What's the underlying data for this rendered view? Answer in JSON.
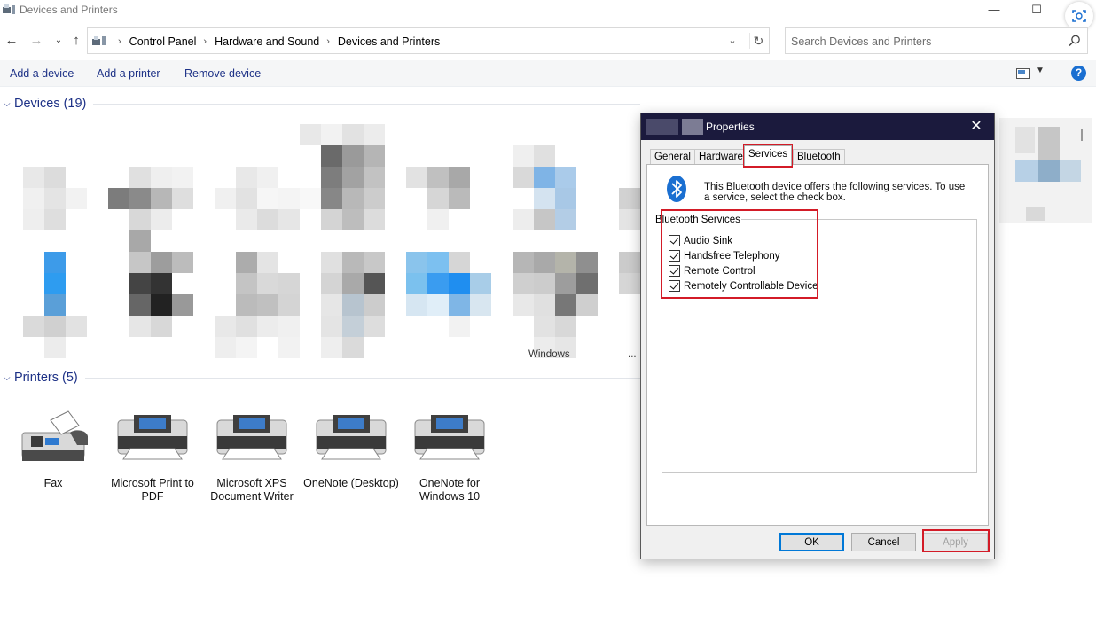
{
  "window": {
    "title": "Devices and Printers",
    "minimize_glyph": "—",
    "maximize_glyph": "☐",
    "close_glyph": "✕"
  },
  "address": {
    "breadcrumbs": [
      "Control Panel",
      "Hardware and Sound",
      "Devices and Printers"
    ],
    "separator": "›",
    "search_placeholder": "Search Devices and Printers"
  },
  "commands": {
    "add_device": "Add a device",
    "add_printer": "Add a printer",
    "remove_device": "Remove device"
  },
  "groups": {
    "devices": "Devices (19)",
    "printers": "Printers (5)"
  },
  "devices": {
    "cut_label_1": "Windows",
    "cut_label_2": "..."
  },
  "printers": [
    {
      "label": "Fax",
      "icon": "fax-icon"
    },
    {
      "label": "Microsoft Print to PDF",
      "icon": "printer-icon"
    },
    {
      "label": "Microsoft XPS Document Writer",
      "icon": "printer-icon"
    },
    {
      "label": "OneNote (Desktop)",
      "icon": "printer-icon"
    },
    {
      "label": "OneNote for Windows 10",
      "icon": "printer-icon"
    }
  ],
  "dialog": {
    "title": "Properties",
    "close_glyph": "✕",
    "tabs": [
      "General",
      "Hardware",
      "Services",
      "Bluetooth"
    ],
    "active_tab": "Services",
    "intro_text": "This Bluetooth device offers the following services. To use a service, select the check box.",
    "services_group_title": "Bluetooth Services",
    "services": [
      {
        "label": "Audio Sink",
        "checked": true
      },
      {
        "label": "Handsfree Telephony",
        "checked": true
      },
      {
        "label": "Remote Control",
        "checked": true
      },
      {
        "label": "Remotely Controllable Device",
        "checked": true
      }
    ],
    "buttons": {
      "ok": "OK",
      "cancel": "Cancel",
      "apply": "Apply"
    }
  },
  "colors": {
    "link_blue": "#1e3287",
    "highlight_red": "#d31b27",
    "dialog_title_bg": "#1b1a3d",
    "accent": "#0078d7"
  }
}
